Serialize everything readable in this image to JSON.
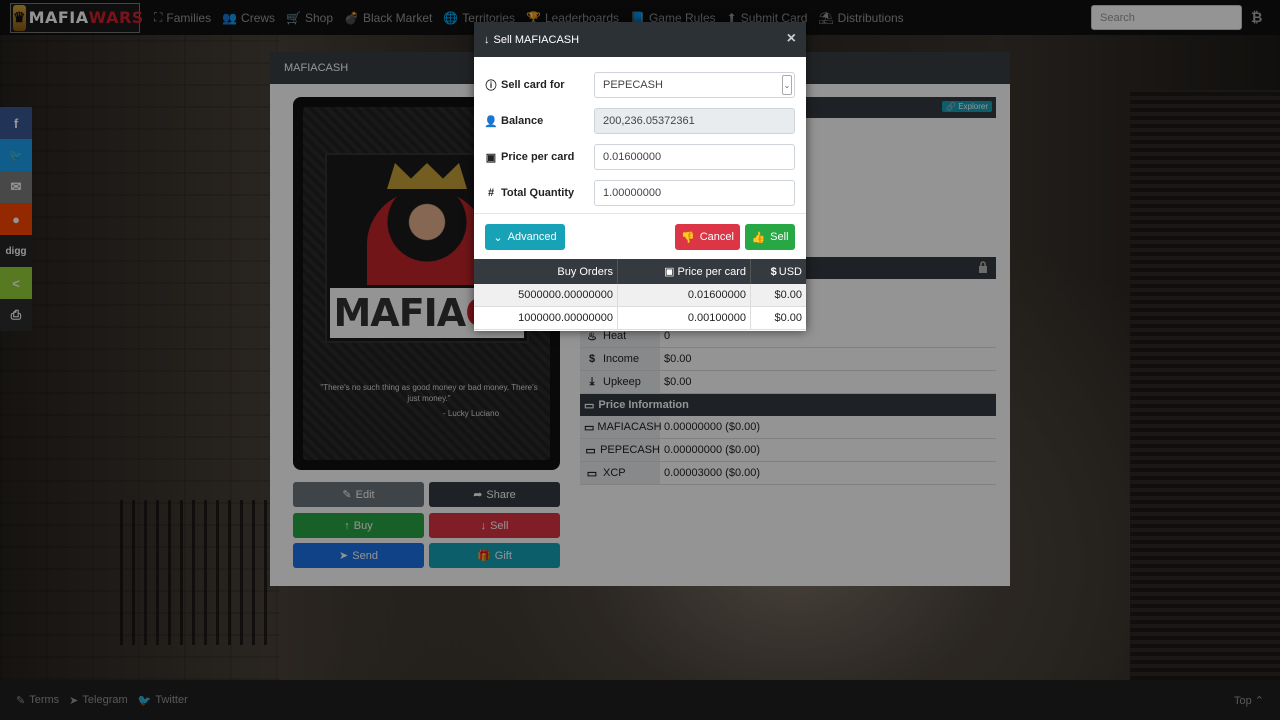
{
  "brand": {
    "part1": "MAFIA",
    "part2": "WARS"
  },
  "nav": [
    {
      "label": "Families",
      "icon": "sitemap-icon",
      "glyph": "⛶"
    },
    {
      "label": "Crews",
      "icon": "users-icon",
      "glyph": "👥"
    },
    {
      "label": "Shop",
      "icon": "cart-icon",
      "glyph": "🛒"
    },
    {
      "label": "Black Market",
      "icon": "bomb-icon",
      "glyph": "💣"
    },
    {
      "label": "Territories",
      "icon": "globe-icon",
      "glyph": "🌐"
    },
    {
      "label": "Leaderboards",
      "icon": "trophy-icon",
      "glyph": "🏆"
    },
    {
      "label": "Game Rules",
      "icon": "book-icon",
      "glyph": "📘"
    },
    {
      "label": "Submit Card",
      "icon": "upload-icon",
      "glyph": "⬆"
    },
    {
      "label": "Distributions",
      "icon": "parachute-icon",
      "glyph": "⛱"
    }
  ],
  "search": {
    "placeholder": "Search"
  },
  "share": [
    {
      "name": "facebook",
      "glyph": "f",
      "color": "#3b5998"
    },
    {
      "name": "twitter",
      "glyph": "🐦",
      "color": "#1da1f2"
    },
    {
      "name": "email",
      "glyph": "✉",
      "color": "#7d7d7d"
    },
    {
      "name": "reddit",
      "glyph": "●",
      "color": "#ff4500"
    },
    {
      "name": "digg",
      "glyph": "digg",
      "color": "#262626"
    },
    {
      "name": "sharethis",
      "glyph": "<",
      "color": "#95d03a"
    },
    {
      "name": "print",
      "glyph": "⎙",
      "color": "#2d2d2d"
    }
  ],
  "card": {
    "title": "MAFIACASH",
    "brand_left": "MAFIA",
    "brand_right": "CA",
    "quote": "\"There's no such thing as good money or bad money. There's just money.\"",
    "author": "- Lucky Luciano"
  },
  "actions": {
    "edit": "Edit",
    "share": "Share",
    "buy": "Buy",
    "sell": "Sell",
    "send": "Send",
    "gift": "Gift"
  },
  "info": {
    "explorer": "Explorer",
    "stats": [
      {
        "label": "Heat",
        "value": "0",
        "icon": "fire-icon",
        "glyph": "🔥"
      },
      {
        "label": "Income",
        "value": "$0.00",
        "icon": "dollar-icon",
        "glyph": "$"
      },
      {
        "label": "Upkeep",
        "value": "$0.00",
        "icon": "hand-icon",
        "glyph": "⤓"
      }
    ],
    "price_section": "Price Information",
    "prices": [
      {
        "label": "MAFIACASH",
        "value": "0.00000000 ($0.00)"
      },
      {
        "label": "PEPECASH",
        "value": "0.00000000 ($0.00)"
      },
      {
        "label": "XCP",
        "value": "0.00003000 ($0.00)"
      }
    ]
  },
  "modal": {
    "title": "Sell MAFIACASH",
    "close": "×",
    "fields": {
      "sell_for_label": "Sell card for",
      "sell_for_value": "PEPECASH",
      "balance_label": "Balance",
      "balance_value": "200,236.05372361",
      "price_label": "Price per card",
      "price_value": "0.01600000",
      "qty_label": "Total Quantity",
      "qty_value": "1.00000000"
    },
    "buttons": {
      "advanced": "Advanced",
      "cancel": "Cancel",
      "sell": "Sell"
    },
    "orders": {
      "headers": [
        "Buy Orders",
        "Price per card",
        "USD"
      ],
      "rows": [
        [
          "5000000.00000000",
          "0.01600000",
          "$0.00"
        ],
        [
          "1000000.00000000",
          "0.00100000",
          "$0.00"
        ]
      ]
    }
  },
  "footer": {
    "terms": "Terms",
    "telegram": "Telegram",
    "twitter": "Twitter",
    "top": "Top"
  },
  "colors": {
    "primary_blue": "#1a73e8",
    "success": "#28a745",
    "danger": "#dc3545",
    "info": "#17a2b8",
    "secondary": "#6c757d",
    "dark": "#343a40"
  }
}
